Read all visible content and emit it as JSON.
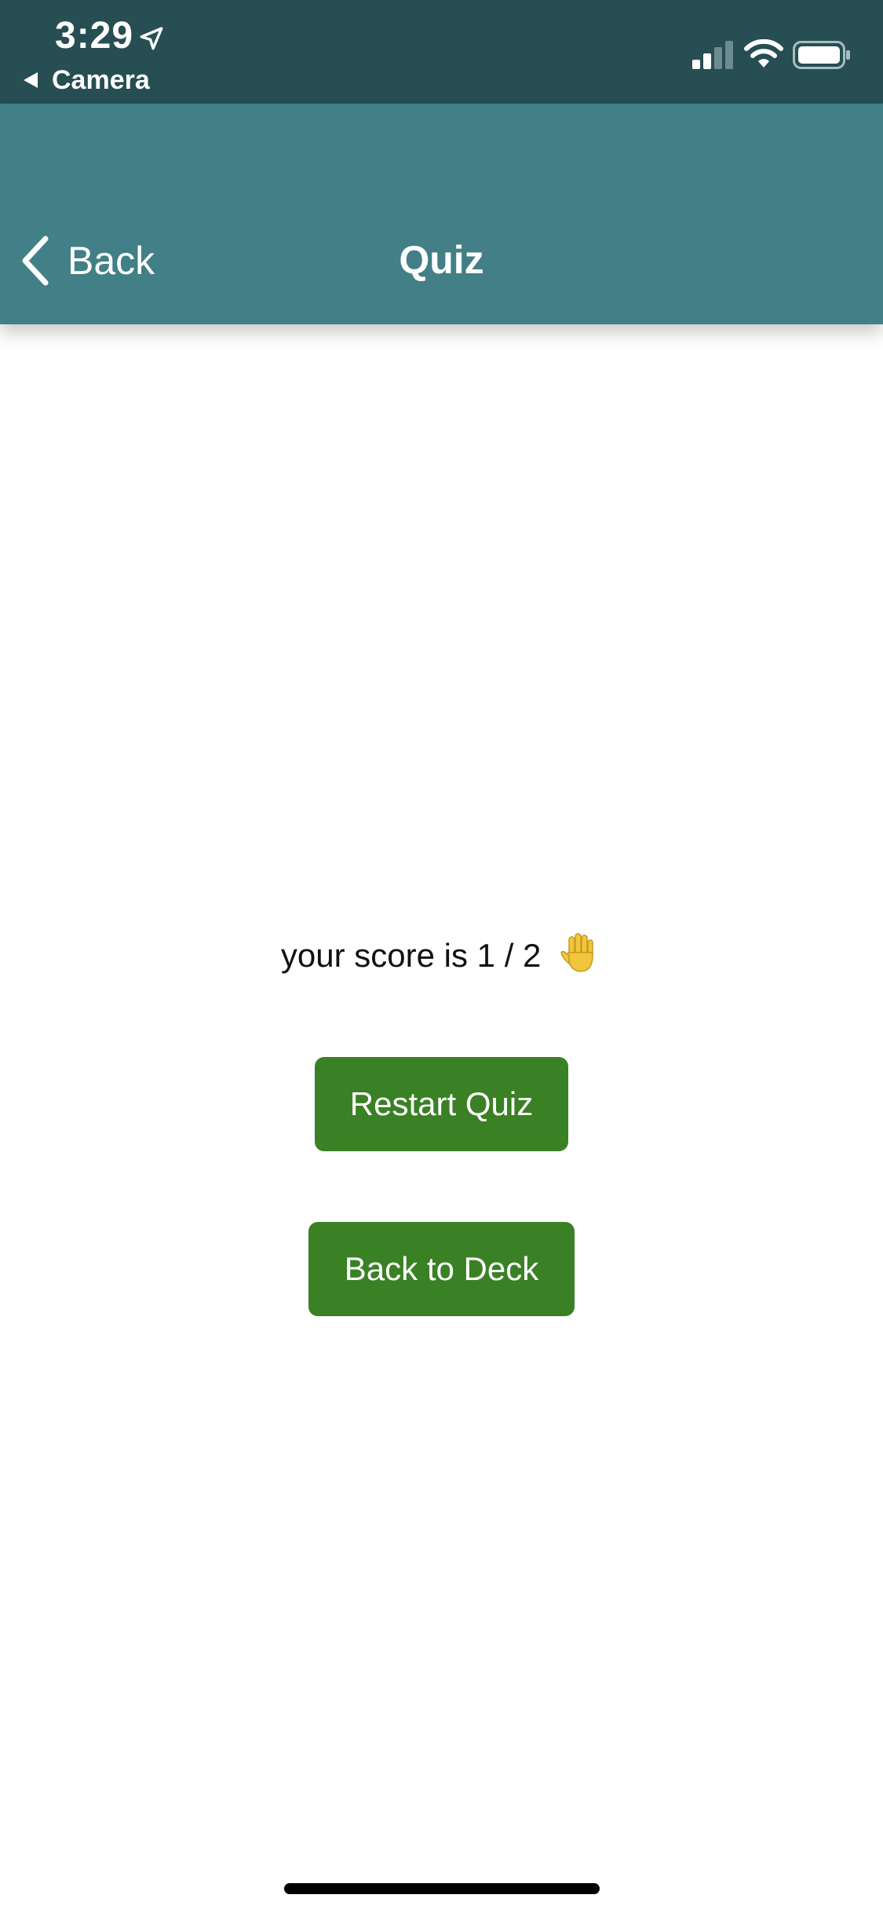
{
  "status_bar": {
    "time": "3:29",
    "back_app_label": "Camera",
    "icons": [
      "location-arrow-icon",
      "signal-icon",
      "wifi-icon",
      "battery-icon"
    ]
  },
  "header": {
    "back_label": "Back",
    "title": "Quiz"
  },
  "main": {
    "score_text": "your score is 1 / 2",
    "score_emoji": "raised-hand-icon",
    "restart_label": "Restart Quiz",
    "back_to_deck_label": "Back to Deck"
  },
  "colors": {
    "status_bar_bg": "#264e53",
    "header_bg": "#427f86",
    "button_bg": "#3a8024"
  }
}
